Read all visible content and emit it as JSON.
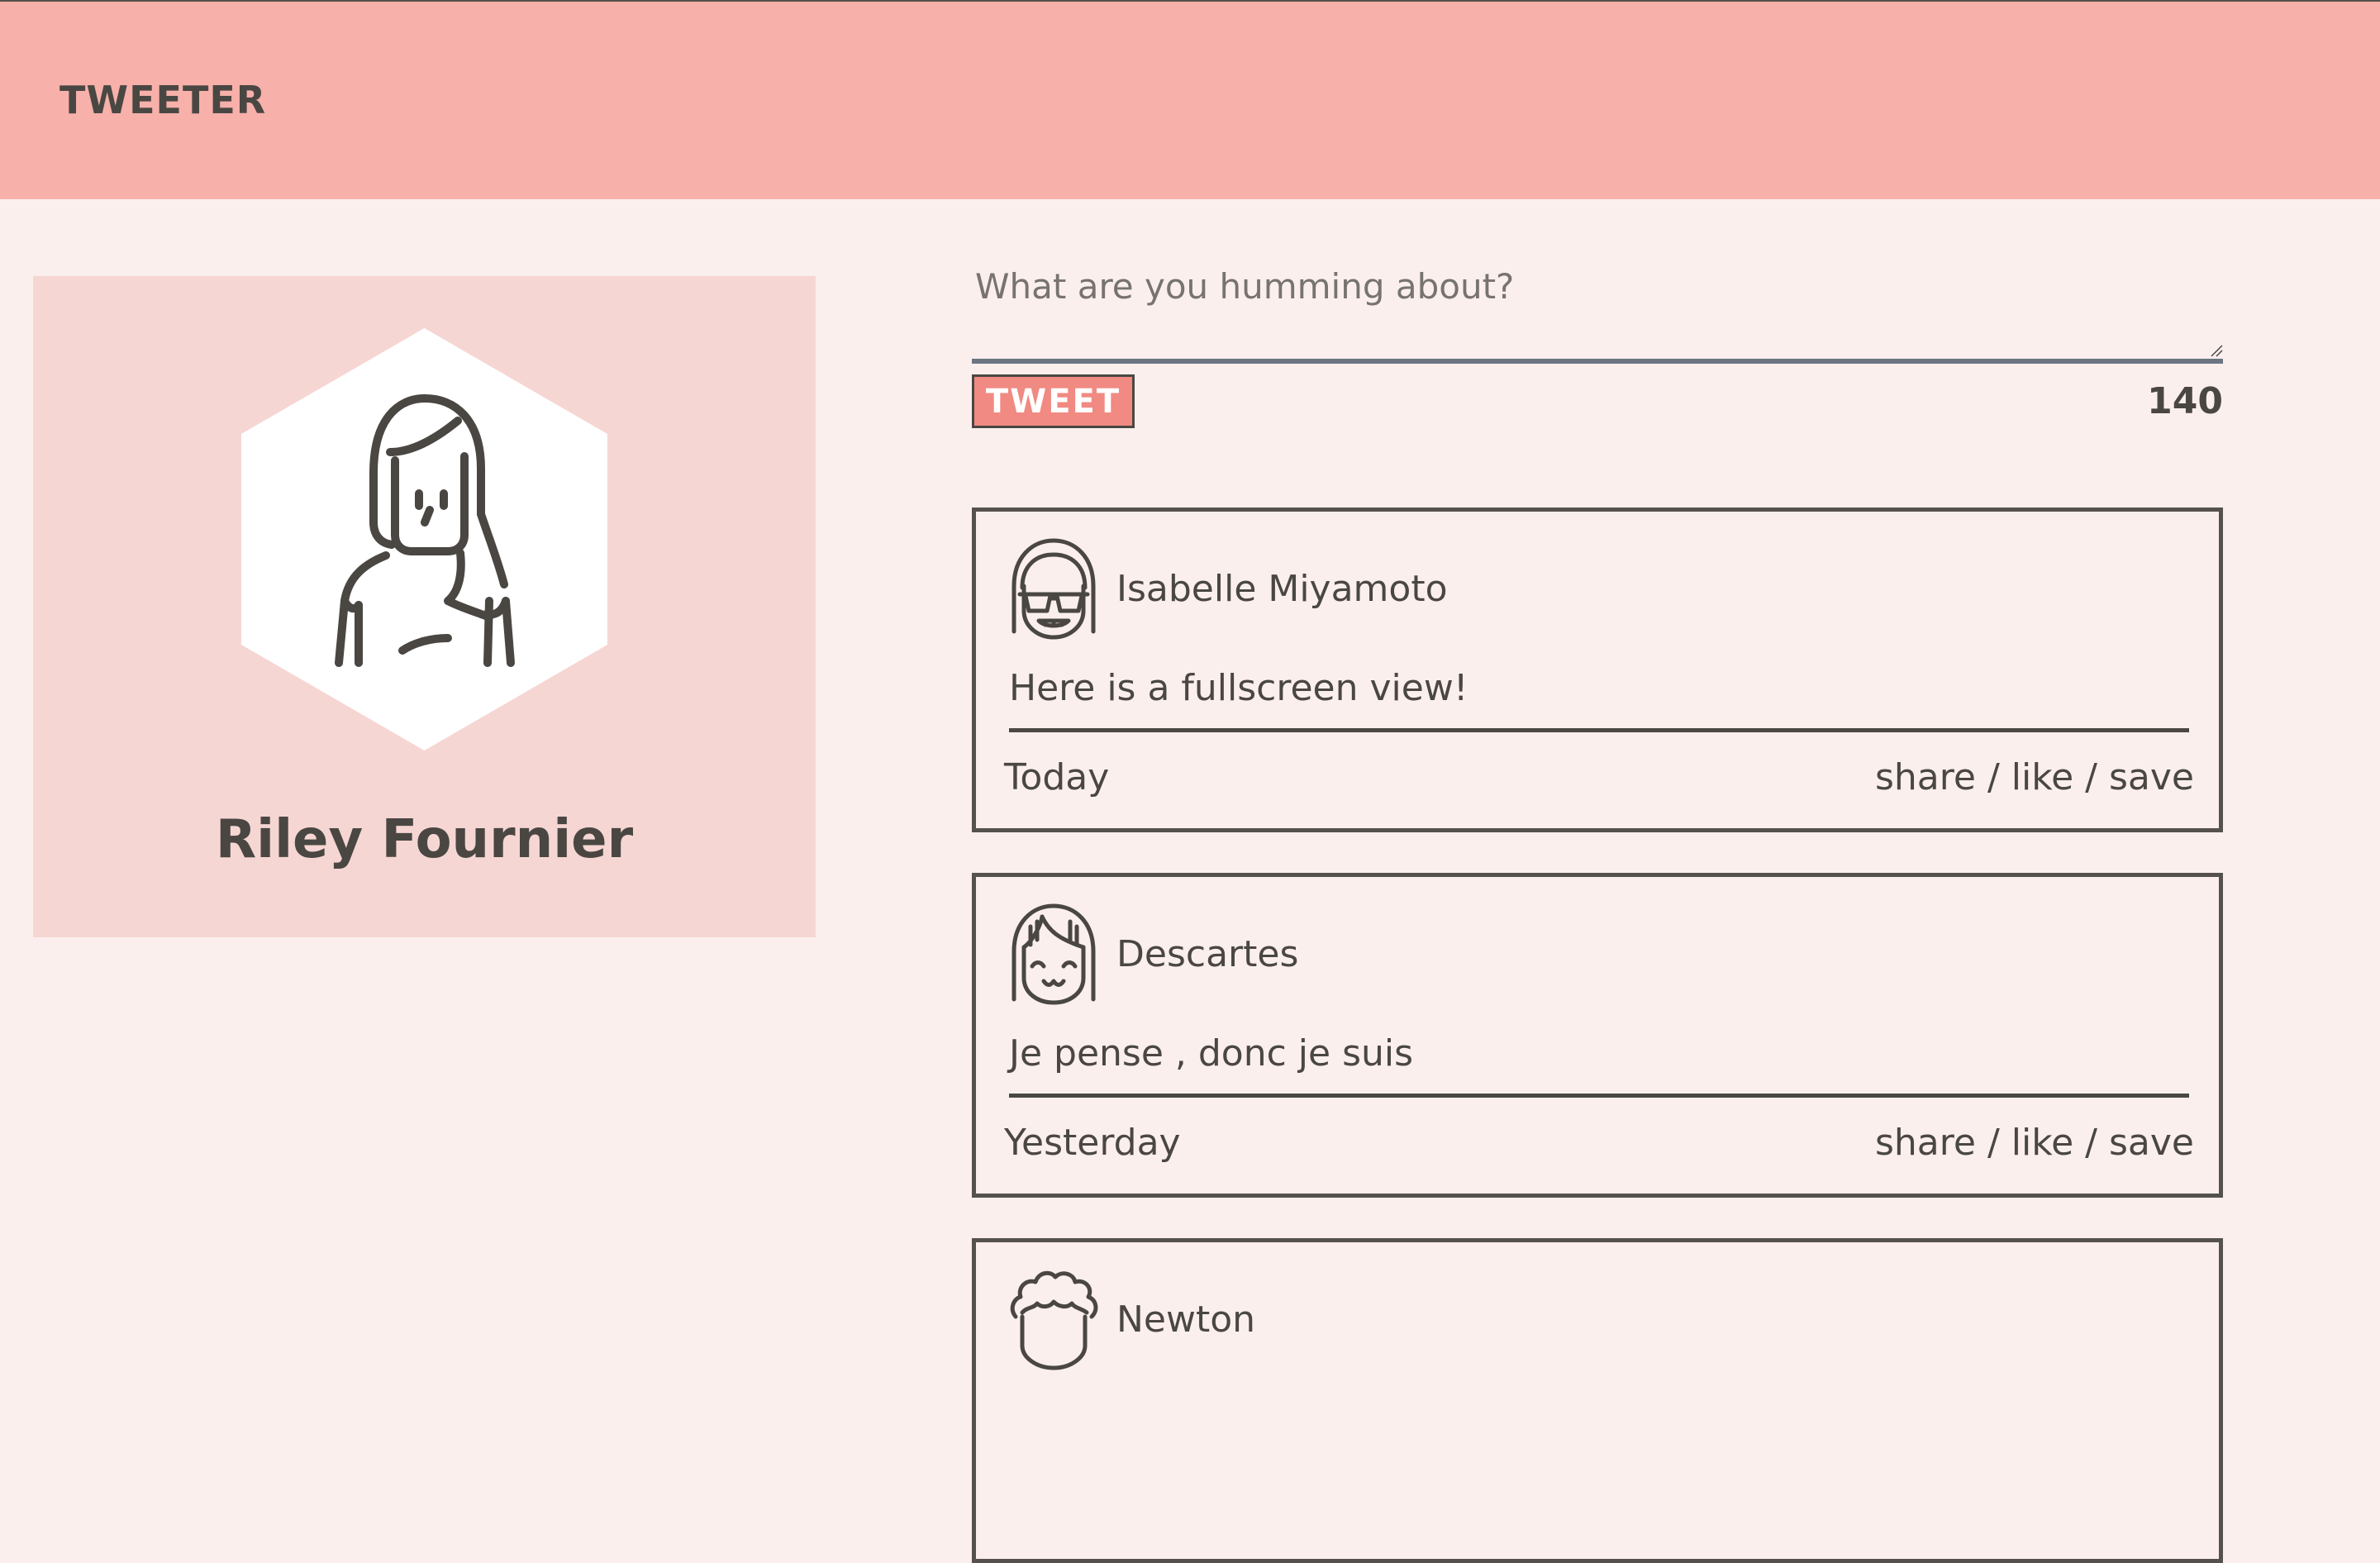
{
  "header": {
    "brand": "TWEETER"
  },
  "profile": {
    "name": "Riley Fournier",
    "avatar_icon": "woman-avatar-icon"
  },
  "composer": {
    "placeholder": "What are you humming about?",
    "value": "",
    "button_label": "TWEET",
    "char_count": "140"
  },
  "tweets": [
    {
      "author": "Isabelle Miyamoto",
      "avatar_icon": "sunglasses-girl-avatar-icon",
      "content": "Here is a fullscreen view!",
      "time": "Today",
      "actions": "share / like / save"
    },
    {
      "author": "Descartes",
      "avatar_icon": "smiling-girl-avatar-icon",
      "content": "Je pense , donc je suis",
      "time": "Yesterday",
      "actions": "share / like / save"
    },
    {
      "author": "Newton",
      "avatar_icon": "curly-hair-avatar-icon",
      "content": "",
      "time": "",
      "actions": ""
    }
  ],
  "colors": {
    "header_bg": "#f7b0aa",
    "page_bg": "#fbefee",
    "card_bg": "#f6d6d3",
    "accent": "#f08a82",
    "ink": "#4a4743"
  }
}
